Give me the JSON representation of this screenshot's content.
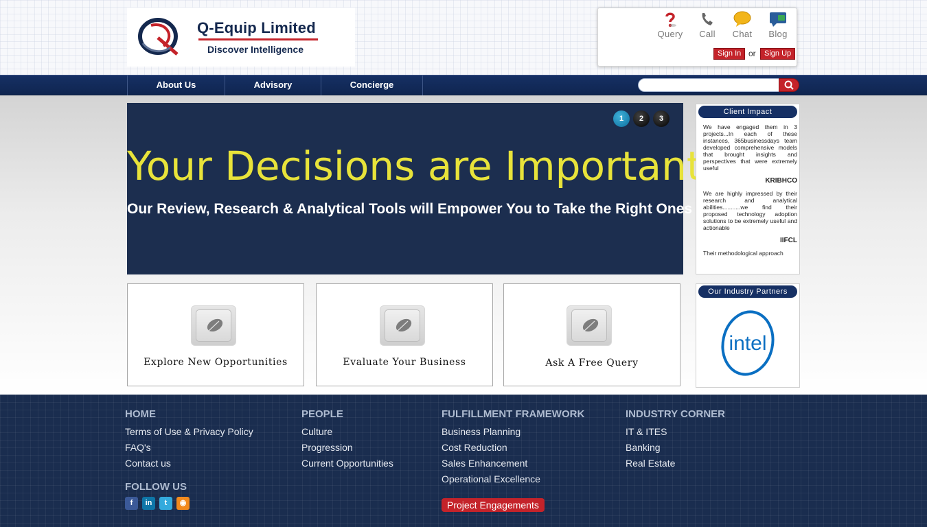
{
  "header": {
    "title": "Q-Equip Limited",
    "tagline": "Discover Intelligence",
    "utility": [
      {
        "label": "Query",
        "icon": "question-icon"
      },
      {
        "label": "Call",
        "icon": "phone-icon"
      },
      {
        "label": "Chat",
        "icon": "chat-bubble-icon"
      },
      {
        "label": "Blog",
        "icon": "blog-icon"
      }
    ],
    "sign_in": "Sign In",
    "or": "or",
    "sign_up": "Sign Up"
  },
  "nav": {
    "items": [
      "About Us",
      "Advisory",
      "Concierge"
    ],
    "search_placeholder": ""
  },
  "slider": {
    "heading": "Your Decisions are Important",
    "subheading": "Our Review, Research & Analytical Tools will Empower You to Take the Right Ones",
    "dots": [
      "1",
      "2",
      "3"
    ],
    "active_dot": "1"
  },
  "client_impact": {
    "title": "Client Impact",
    "testimonials": [
      {
        "text": "We have engaged them in 3 projects...In each of these instances, 365businessdays team developed comprehensive models that brought insights and perspectives that were extremely useful",
        "client": "KRIBHCO"
      },
      {
        "text": "We are highly impressed by their research and analytical abilities...........we find their proposed technology adoption solutions to be extremely useful and actionable",
        "client": "IIFCL"
      },
      {
        "text": "Their methodological approach",
        "client": ""
      }
    ]
  },
  "cards": [
    {
      "label": "Explore New Opportunities"
    },
    {
      "label": "Evaluate Your Business"
    },
    {
      "label": "Ask A Free Query"
    }
  ],
  "partners": {
    "title": "Our Industry Partners",
    "logo_text": "intel"
  },
  "footer": {
    "col1": {
      "head": "HOME",
      "links": [
        "Terms of Use & Privacy Policy",
        "FAQ's",
        "Contact us"
      ]
    },
    "follow": {
      "head": "FOLLOW US",
      "icons": [
        "facebook-icon",
        "linkedin-icon",
        "twitter-icon",
        "rss-icon"
      ]
    },
    "col2": {
      "head": "PEOPLE",
      "links": [
        "Culture",
        "Progression",
        "Current Opportunities"
      ]
    },
    "col3": {
      "head": "FULFILLMENT FRAMEWORK",
      "links": [
        "Business Planning",
        "Cost Reduction",
        "Sales Enhancement",
        "Operational Excellence"
      ]
    },
    "project_button": "Project Engagements",
    "col4": {
      "head": "INDUSTRY CORNER",
      "links": [
        "IT & ITES",
        "Banking",
        "Real Estate"
      ]
    }
  },
  "colors": {
    "brand_navy": "#163064",
    "accent_red": "#c4232a",
    "slide_yellow": "#e8e33a"
  }
}
